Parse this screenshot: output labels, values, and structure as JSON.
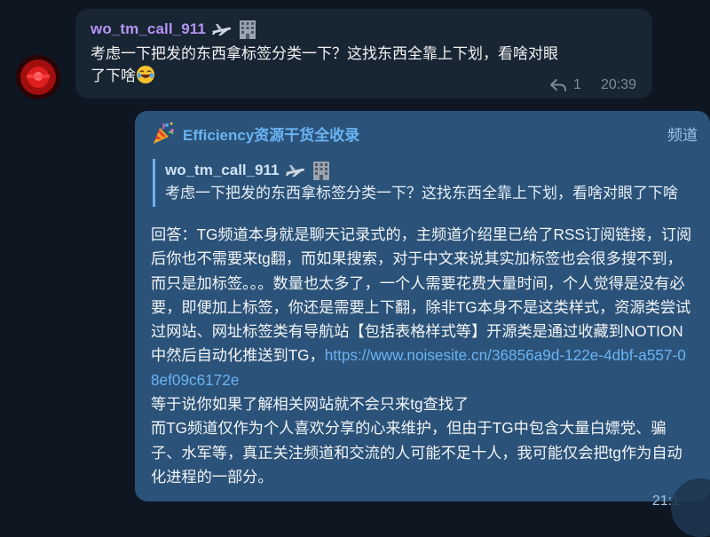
{
  "incoming": {
    "sender": "wo_tm_call_911",
    "sender_emojis": [
      "airplane-icon",
      "building-icon"
    ],
    "text_line1": "考虑一下把发的东西拿标签分类一下？这找东西全靠上下划，看啥对眼",
    "text_line2": "了下啥",
    "reply_count": "1",
    "time": "20:39",
    "name_color": "#b394f2"
  },
  "post": {
    "channel_name": "Efficiency资源干货全收录",
    "badge": "频道",
    "quote": {
      "sender": "wo_tm_call_911",
      "text": "考虑一下把发的东西拿标签分类一下？这找东西全靠上下划，看啥对眼了下啥"
    },
    "answer_part1": "回答：TG频道本身就是聊天记录式的，主频道介绍里已给了RSS订阅链接，订阅后你也不需要来tg翻，而如果搜索，对于中文来说其实加标签也会很多搜不到，而只是加标签。。。数量也太多了，一个人需要花费大量时间，个人觉得是没有必要，即便加上标签，你还是需要上下翻，除非TG本身不是这类样式，资源类尝试过网站、网址标签类有导航站【包括表格样式等】开源类是通过收藏到NOTION中然后自动化推送到TG，",
    "link": "https://www.noisesite.cn/36856a9d-122e-4dbf-a557-08ef09c6172e",
    "answer_part2": "等于说你如果了解相关网站就不会只来tg查找了",
    "answer_part3": "而TG频道仅作为个人喜欢分享的心来维护，但由于TG中包含大量白嫖党、骗子、水军等，真正关注频道和交流的人可能不足十人，我可能仅会把tg作为自动化进程的一部分。",
    "time": "21:1",
    "link_color": "#6ab3f3",
    "bubble_color": "#2b5278"
  }
}
